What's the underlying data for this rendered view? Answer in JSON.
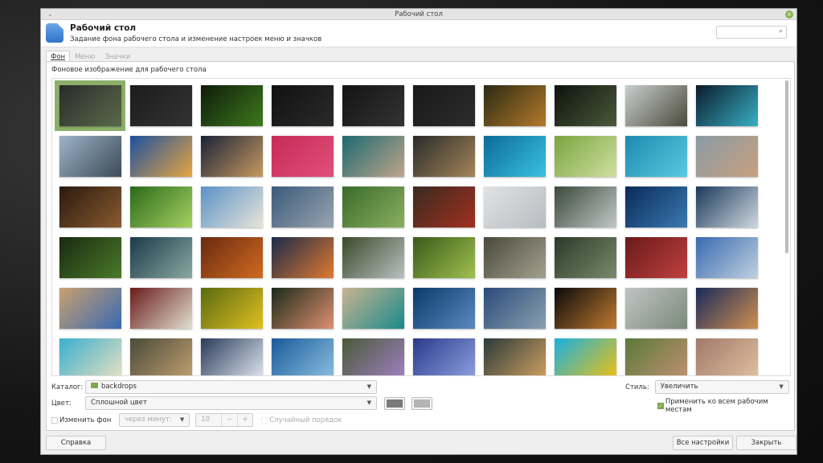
{
  "window": {
    "title": "Рабочий стол",
    "menu_icon": "⌄",
    "close_icon": "×"
  },
  "header": {
    "title": "Рабочий стол",
    "subtitle": "Задание фона рабочего стола и изменение настроек меню и значков",
    "search_placeholder": "",
    "search_icon": "⌕"
  },
  "tabs": [
    {
      "label": "Фон",
      "active": true
    },
    {
      "label": "Меню"
    },
    {
      "label": "Значки"
    }
  ],
  "background": {
    "section_label": "Фоновое изображение для рабочего стола",
    "thumbnails": [
      [
        "#2a2a2a",
        "#5a6a4a"
      ],
      [
        "#1c1c1c",
        "#333"
      ],
      [
        "#0f1a0a",
        "#3d7a1e"
      ],
      [
        "#111",
        "#2a2a2a"
      ],
      [
        "#141414",
        "#333"
      ],
      [
        "#181818",
        "#2c2c2c"
      ],
      [
        "#2b2a14",
        "#b47a2a"
      ],
      [
        "#0d120d",
        "#4a5a3a"
      ],
      [
        "#c9cfcf",
        "#4a4a3a"
      ],
      [
        "#0b1a2c",
        "#38b0c4"
      ],
      [
        "#9cb4c8",
        "#3c4a56"
      ],
      [
        "#1e50a0",
        "#e6a640"
      ],
      [
        "#1a2238",
        "#c79a60"
      ],
      [
        "#c82a56",
        "#e0507a"
      ],
      [
        "#1c6a72",
        "#c0a48a"
      ],
      [
        "#2a2a2a",
        "#a4865a"
      ],
      [
        "#0c6a9a",
        "#3ac2e0"
      ],
      [
        "#7aa440",
        "#cfe0a0"
      ],
      [
        "#1c8ab0",
        "#5acbe0"
      ],
      [
        "#8a9aa4",
        "#c8a080"
      ],
      [
        "#2a1a10",
        "#8a5a30"
      ],
      [
        "#2a6a1a",
        "#a6d060"
      ],
      [
        "#5a92c8",
        "#e8e4d8"
      ],
      [
        "#3a5a7a",
        "#9aa4b0"
      ],
      [
        "#3a6a2a",
        "#8ab060"
      ],
      [
        "#3a2a20",
        "#a03020"
      ],
      [
        "#e0e2e4",
        "#b8bcc0"
      ],
      [
        "#3a4a3a",
        "#c0c8c8"
      ],
      [
        "#0a2a5a",
        "#3a7ab0"
      ],
      [
        "#1a3a5a",
        "#d0d8e0"
      ],
      [
        "#1a2a12",
        "#4a7a2a"
      ],
      [
        "#1a3a4a",
        "#8aa8a0"
      ],
      [
        "#6a2a10",
        "#d06a20"
      ],
      [
        "#1a2a4a",
        "#e07a30"
      ],
      [
        "#3a4a2a",
        "#b8c0c0"
      ],
      [
        "#3a5a1a",
        "#a0c050"
      ],
      [
        "#4a4a3a",
        "#a4a090"
      ],
      [
        "#2a3a2a",
        "#7a8a6a"
      ],
      [
        "#6a1a1a",
        "#c04040"
      ],
      [
        "#3a6ab0",
        "#c0d0e0"
      ],
      [
        "#c8a070",
        "#3a6ab0"
      ],
      [
        "#6a1a1a",
        "#e0e0d0"
      ],
      [
        "#5a6a10",
        "#e0c020"
      ],
      [
        "#1a2a1a",
        "#e09070"
      ],
      [
        "#c8b490",
        "#1a8a8a"
      ],
      [
        "#0a3a6a",
        "#5a8ac0"
      ],
      [
        "#2a4a7a",
        "#8aa0b0"
      ],
      [
        "#0a0a0a",
        "#c07a30"
      ],
      [
        "#c0c4c4",
        "#7a8a7a"
      ],
      [
        "#1a2a5a",
        "#d09050"
      ],
      [
        "#3ab0d0",
        "#e8e0c0"
      ],
      [
        "#4a4a3a",
        "#c0a070"
      ],
      [
        "#2a3a5a",
        "#e0e8f0"
      ],
      [
        "#1a5a9a",
        "#8ac0e0"
      ],
      [
        "#4a5a3a",
        "#a080c0"
      ],
      [
        "#2a3a8a",
        "#90a0e0"
      ],
      [
        "#2a3a3a",
        "#d0a060"
      ],
      [
        "#1ab0e0",
        "#f0c010"
      ],
      [
        "#5a7a3a",
        "#c09070"
      ],
      [
        "#a07a6a",
        "#e0c0a0"
      ]
    ],
    "catalog_label": "Каталог:",
    "catalog_value": "backdrops",
    "color_label": "Цвет:",
    "color_value": "Сплошной цвет",
    "primary_color": "#7a7a7a",
    "secondary_color": "#b4b4b4",
    "style_label": "Стиль:",
    "style_value": "Увеличить",
    "apply_all_label": "Применить ко всем рабочим местам",
    "apply_all_checked": true,
    "change_label": "Изменить фон",
    "interval_value": "через минут:",
    "minutes_value": "10",
    "minus": "−",
    "plus": "+",
    "random_label": "Случайный порядок"
  },
  "footer": {
    "help": "Справка",
    "all_settings": "Все настройки",
    "close": "Закрыть"
  }
}
